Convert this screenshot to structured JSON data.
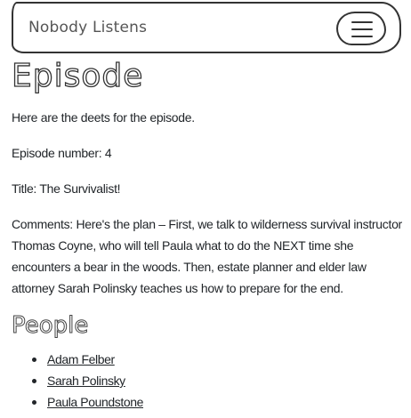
{
  "header": {
    "brand": "Nobody Listens",
    "menu_icon": "hamburger-menu-icon"
  },
  "page": {
    "title": "Episode",
    "intro": "Here are the deets for the episode.",
    "episode_number_line": "Episode number: 4",
    "title_line": "Title: The Survivalist!",
    "comments_line": "Comments: Here's the plan – First, we talk to wilderness survival instructor Thomas Coyne, who will tell Paula what to do the NEXT time she encounters a bear in the woods. Then, estate planner and elder law attorney Sarah Polinsky teaches us how to prepare for the end."
  },
  "people": {
    "heading": "People",
    "items": [
      {
        "name": "Adam Felber"
      },
      {
        "name": "Sarah Polinsky"
      },
      {
        "name": "Paula Poundstone"
      }
    ]
  }
}
